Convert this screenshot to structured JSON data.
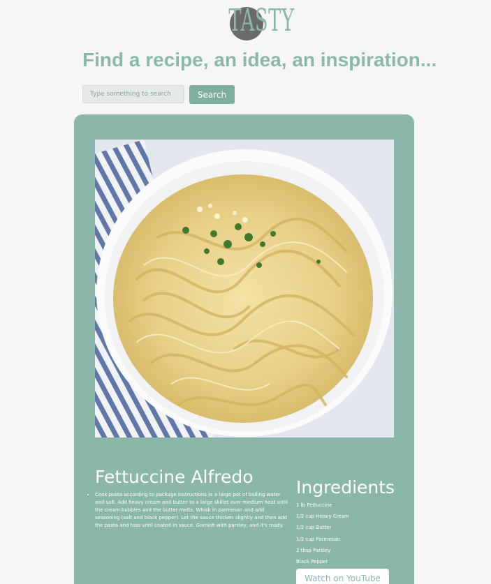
{
  "logo": {
    "text": "TASTY"
  },
  "header": {
    "headline": "Find a recipe, an idea, an inspiration..."
  },
  "search": {
    "placeholder": "Type something to search",
    "value": "",
    "button_label": "Search"
  },
  "recipe": {
    "title": "Fettuccine Alfredo",
    "image_subject": "fettuccine-alfredo-plate",
    "instructions": [
      "Cook pasta according to package instructions in a large pot of boiling water and salt. Add heavy cream and butter to a large skillet over medium heat until the cream bubbles and the butter melts. Whisk in parmesan and add seasoning (salt and black pepper). Let the sauce thicken slightly and then add the pasta and toss until coated in sauce. Garnish with parsley, and it's ready."
    ],
    "ingredients_title": "Ingredients",
    "ingredients": [
      "1 lb Fettuccine",
      "1/2 cup Heavy Cream",
      "1/2 cup Butter",
      "1/2 cup Parmesan",
      "2 tbsp Parsley",
      "Black Pepper"
    ],
    "youtube_label": "Watch on YouTube"
  },
  "colors": {
    "accent": "#8ab8ad",
    "card": "#8bb7ab",
    "button": "#7fae9f",
    "background": "#f6f6f6"
  }
}
